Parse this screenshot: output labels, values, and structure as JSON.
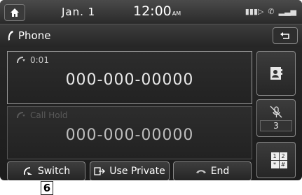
{
  "status_bar": {
    "home_icon": "home-icon",
    "date": "Jan.  1",
    "time": "12:00",
    "ampm": "AM",
    "icons": [
      "battery-icon",
      "call-icon",
      "signal-icon"
    ]
  },
  "title_bar": {
    "icon": "phone-handset-icon",
    "title": "Phone",
    "back_icon": "back-arrow-icon"
  },
  "calls": [
    {
      "status": "0:01",
      "number": "000-000-00000",
      "state": "active"
    },
    {
      "status": "Call Hold",
      "number": "000-000-00000",
      "state": "hold"
    }
  ],
  "side": {
    "contacts_icon": "contacts-icon",
    "mute_icon": "mic-mute-icon",
    "mute_value": "3",
    "keypad_keys": [
      "1",
      "2",
      "*",
      "#"
    ]
  },
  "buttons": {
    "switch": "Switch",
    "use_private": "Use Private",
    "end": "End"
  },
  "callout": "6"
}
